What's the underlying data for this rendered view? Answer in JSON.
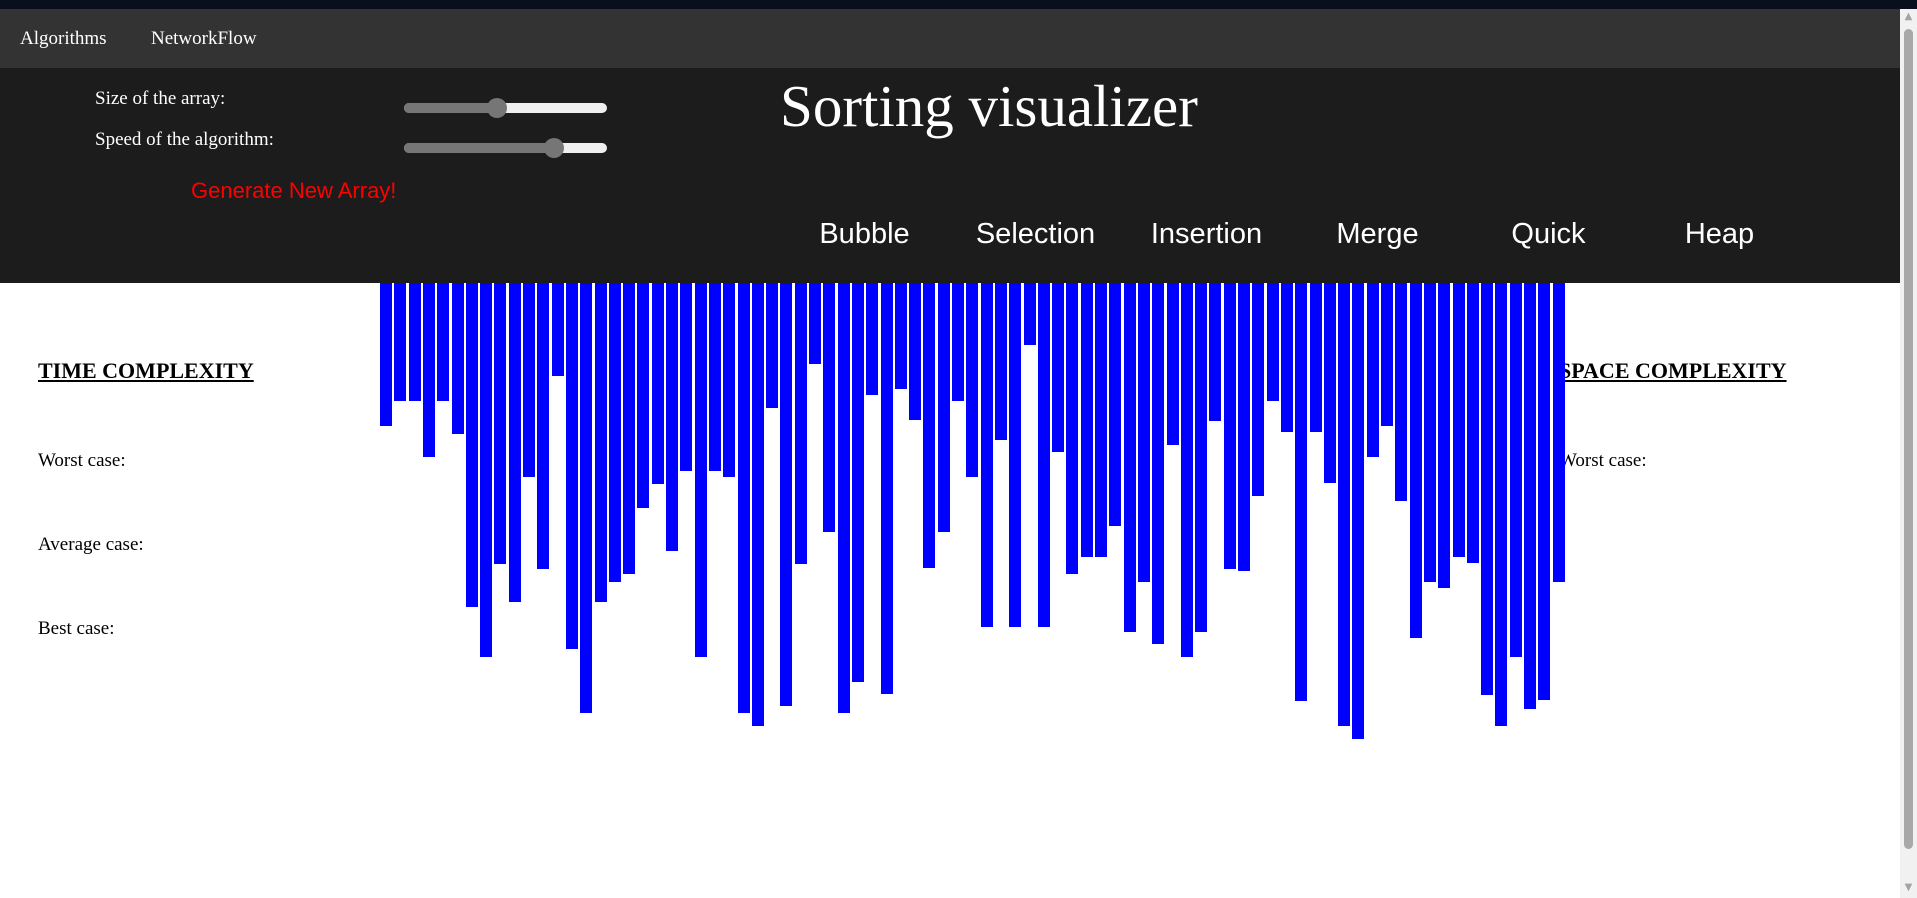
{
  "nav": {
    "items": [
      {
        "label": "Algorithms"
      },
      {
        "label": "NetworkFlow"
      }
    ]
  },
  "controls": {
    "size_label": "Size of the array:",
    "size_value": 0.46,
    "speed_label": "Speed of the algorithm:",
    "speed_value": 0.74,
    "generate_label": "Generate New Array!"
  },
  "title": "Sorting visualizer",
  "algorithms": [
    {
      "label": "Bubble"
    },
    {
      "label": "Selection"
    },
    {
      "label": "Insertion"
    },
    {
      "label": "Merge"
    },
    {
      "label": "Quick"
    },
    {
      "label": "Heap"
    }
  ],
  "time_complexity": {
    "heading": "TIME COMPLEXITY",
    "worst_label": "Worst case:",
    "average_label": "Average case:",
    "best_label": "Best case:"
  },
  "space_complexity": {
    "heading": "SPACE COMPLEXITY",
    "worst_label": "Worst case:"
  },
  "colors": {
    "bar": "#0000ff",
    "navbar": "#333333",
    "panel": "#1c1c1c",
    "generate": "#ff0000"
  },
  "array_values": [
    143,
    118,
    118,
    174,
    118,
    151,
    324,
    374,
    281,
    319,
    194,
    286,
    93,
    366,
    430,
    319,
    299,
    291,
    225,
    201,
    268,
    188,
    374,
    188,
    194,
    430,
    443,
    125,
    423,
    281,
    81,
    249,
    430,
    399,
    112,
    411,
    106,
    137,
    285,
    249,
    118,
    194,
    344,
    157,
    344,
    62,
    344,
    169,
    291,
    274,
    274,
    243,
    349,
    299,
    361,
    162,
    374,
    349,
    138,
    286,
    288,
    213,
    118,
    149,
    418,
    149,
    200,
    443,
    456,
    174,
    143,
    218,
    355,
    299,
    305,
    274,
    280,
    412,
    443,
    374,
    426,
    417,
    299
  ]
}
